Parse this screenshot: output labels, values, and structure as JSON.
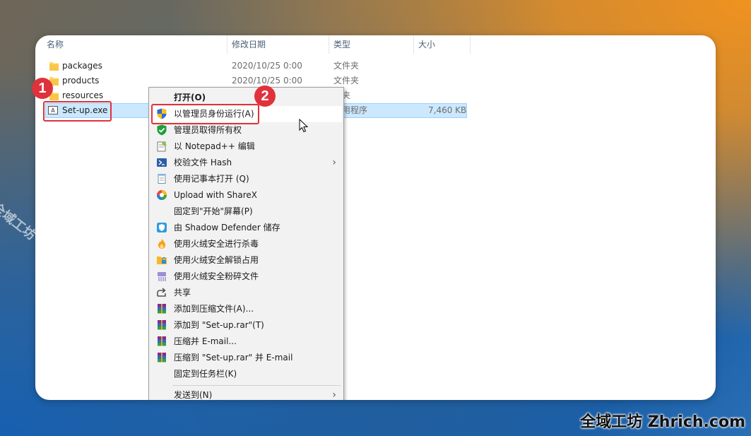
{
  "columns": {
    "name": "名称",
    "modified": "修改日期",
    "type": "类型",
    "size": "大小",
    "sort_indicator": "^"
  },
  "files": [
    {
      "name": "packages",
      "modified": "2020/10/25 0:00",
      "type": "文件夹",
      "size": "",
      "icon": "folder-icon"
    },
    {
      "name": "products",
      "modified": "2020/10/25 0:00",
      "type": "文件夹",
      "size": "",
      "icon": "folder-icon"
    },
    {
      "name": "resources",
      "modified": "",
      "type": "件夹",
      "size": "",
      "icon": "folder-icon"
    },
    {
      "name": "Set-up.exe",
      "modified": "",
      "type": "用程序",
      "size": "7,460 KB",
      "icon": "exe-icon",
      "exe_glyph": "A"
    }
  ],
  "badges": {
    "one": "1",
    "two": "2"
  },
  "context_menu": {
    "items": [
      {
        "label": "打开(O)",
        "icon": "",
        "bold": true
      },
      {
        "label": "以管理员身份运行(A)",
        "icon": "uac-shield-icon",
        "highlighted": true
      },
      {
        "label": "管理员取得所有权",
        "icon": "green-shield-icon"
      },
      {
        "label": "以 Notepad++ 编辑",
        "icon": "notepad-plus-plus-icon"
      },
      {
        "label": "校验文件 Hash",
        "icon": "powershell-icon",
        "submenu": true
      },
      {
        "label": "使用记事本打开 (Q)",
        "icon": "notepad-icon"
      },
      {
        "label": "Upload with ShareX",
        "icon": "sharex-icon"
      },
      {
        "label": "固定到\"开始\"屏幕(P)",
        "icon": ""
      },
      {
        "label": "由 Shadow Defender 储存",
        "icon": "shadow-defender-icon"
      },
      {
        "label": "使用火绒安全进行杀毒",
        "icon": "huorong-antivirus-icon"
      },
      {
        "label": "使用火绒安全解锁占用",
        "icon": "huorong-unlock-icon"
      },
      {
        "label": "使用火绒安全粉碎文件",
        "icon": "huorong-shred-icon"
      },
      {
        "label": "共享",
        "icon": "share-icon"
      },
      {
        "label": "添加到压缩文件(A)...",
        "icon": "winrar-icon"
      },
      {
        "label": "添加到 \"Set-up.rar\"(T)",
        "icon": "winrar-icon"
      },
      {
        "label": "压缩并 E-mail...",
        "icon": "winrar-icon"
      },
      {
        "label": "压缩到 \"Set-up.rar\" 并 E-mail",
        "icon": "winrar-icon"
      },
      {
        "label": "固定到任务栏(K)",
        "icon": ""
      },
      {
        "label": "发送到(N)",
        "icon": "",
        "submenu": true
      }
    ],
    "submenu_arrow": "›"
  },
  "watermarks": {
    "diagonal": "全域工坊 zhrich.com",
    "corner": "全域工坊 Zhrich.com"
  },
  "colors": {
    "selection": "#cce8ff",
    "callout": "#e0323c",
    "background_orange": "#f0921f",
    "background_blue": "#1760b0"
  }
}
